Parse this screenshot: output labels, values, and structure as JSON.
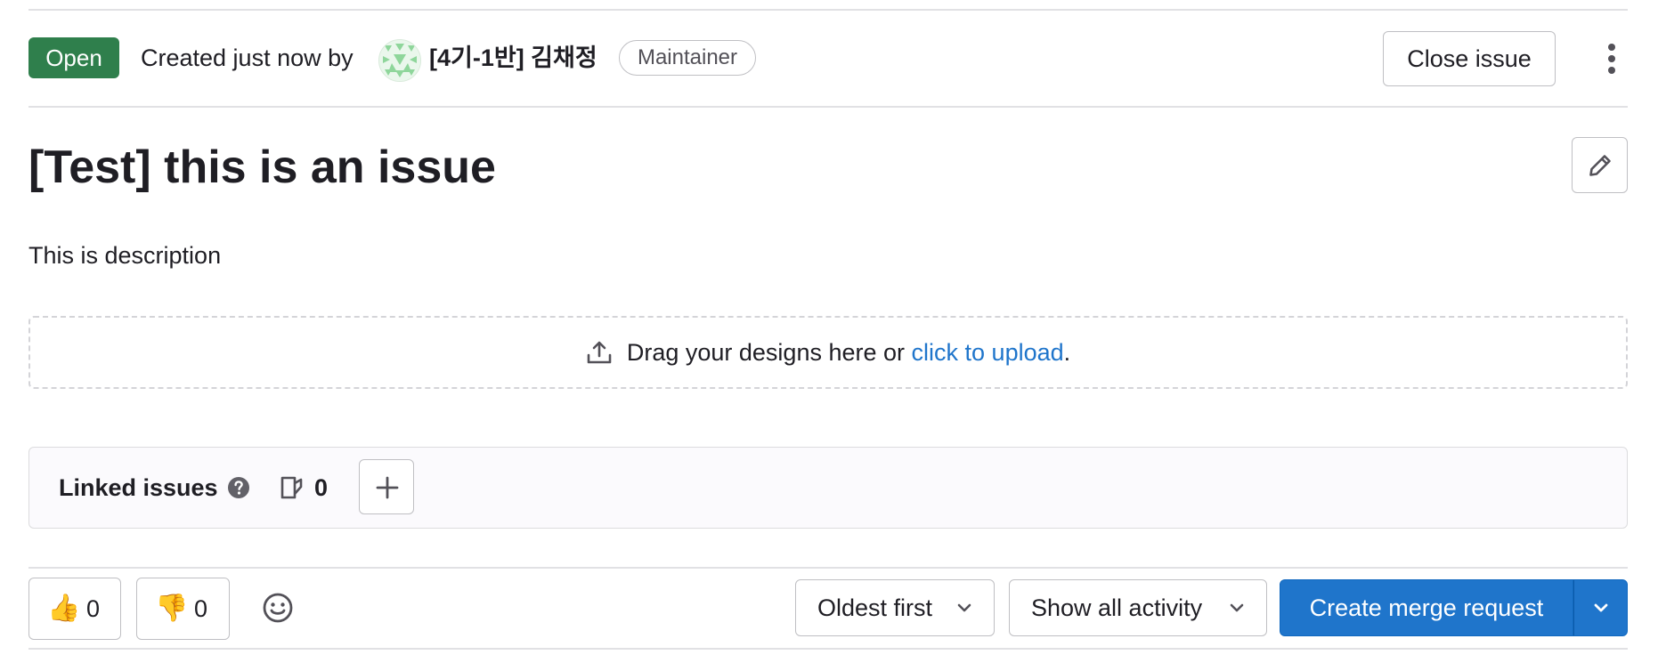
{
  "header": {
    "status": "Open",
    "created_text": "Created just now by",
    "author": "[4기-1반] 김채정",
    "role": "Maintainer",
    "close_label": "Close issue"
  },
  "issue": {
    "title": "[Test] this is an issue",
    "description": "This is description"
  },
  "designs": {
    "prefix": "Drag your designs here or ",
    "link": "click to upload",
    "suffix": "."
  },
  "linked_issues": {
    "title": "Linked issues",
    "count": "0"
  },
  "footer": {
    "thumbs_up_emoji": "👍",
    "thumbs_up_count": "0",
    "thumbs_down_emoji": "👎",
    "thumbs_down_count": "0",
    "sort_label": "Oldest first",
    "activity_label": "Show all activity",
    "merge_request_label": "Create merge request"
  },
  "colors": {
    "open_badge": "#2f7f4c",
    "link": "#1f75cb",
    "primary_button": "#1f75cb",
    "border": "#bfbfc3"
  },
  "icons": [
    "avatar-identicon",
    "kebab-menu-icon",
    "pencil-icon",
    "upload-icon",
    "question-circle-icon",
    "issues-icon",
    "plus-icon",
    "smiley-icon",
    "chevron-down-icon"
  ]
}
